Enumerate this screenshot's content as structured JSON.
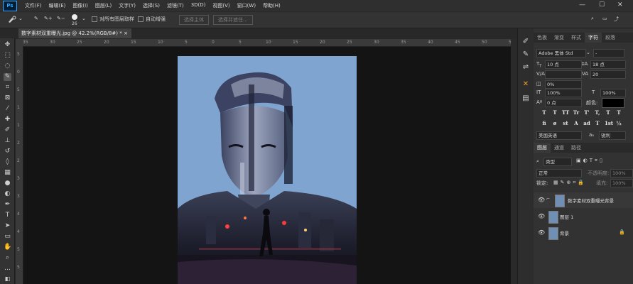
{
  "menubar": {
    "items": [
      "文件(F)",
      "编辑(E)",
      "图像(I)",
      "图层(L)",
      "文字(Y)",
      "选择(S)",
      "滤镜(T)",
      "3D(D)",
      "视图(V)",
      "窗口(W)",
      "帮助(H)"
    ],
    "app_logo": "Ps",
    "window_controls": [
      "—",
      "☐",
      "✕"
    ]
  },
  "options": {
    "brush_size": "26",
    "sample_all_layers": "对所有图层取样",
    "auto_enhance": "自动增强",
    "select_subject": "选择主体",
    "select_and_mask": "选择并遮住..."
  },
  "document": {
    "tab_title": "数字素材双重曝光.jpg @ 42.2%(RGB/8#) *",
    "close": "×"
  },
  "ruler": {
    "h_marks": [
      "35",
      "30",
      "25",
      "20",
      "15",
      "10",
      "5",
      "0",
      "5",
      "10",
      "15",
      "20",
      "25",
      "30",
      "35",
      "40",
      "45",
      "50",
      "55"
    ],
    "v_marks": [
      "5",
      "0",
      "5",
      "1",
      "1",
      "2",
      "2",
      "3",
      "3",
      "4",
      "4",
      "5",
      "5"
    ]
  },
  "panels": {
    "top_tabs": [
      "色板",
      "渐变",
      "样式",
      "字符",
      "段落"
    ],
    "active_top_tab": "字符",
    "character": {
      "font_family": "Adobe 黑体 Std",
      "font_style": "-",
      "font_size": "10 点",
      "leading": "18 点",
      "kerning": "V/A",
      "tracking": "20",
      "tsume": "0%",
      "vertical_scale": "100%",
      "horizontal_scale": "100%",
      "baseline_shift": "0 点",
      "color_label": "颜色:",
      "style_buttons": [
        "T",
        "T",
        "TT",
        "Tr",
        "T'",
        "T,",
        "T",
        "T"
      ],
      "opentype_buttons": [
        "fi",
        "ø",
        "st",
        "A",
        "ad",
        "T",
        "1st",
        "½"
      ],
      "language": "美国英语",
      "antialias": "锐利",
      "aa_prefix": "aₐ"
    },
    "layers": {
      "tabs": [
        "图层",
        "通道",
        "路径"
      ],
      "active_tab": "图层",
      "filter_kind": "类型",
      "blend_mode": "正常",
      "opacity_label": "不透明度:",
      "opacity": "100%",
      "lock_label": "锁定:",
      "fill_label": "填充:",
      "fill": "100%",
      "items": [
        {
          "name": "数字素材双重曝光背景",
          "visible": true
        },
        {
          "name": "图层 1",
          "visible": true
        },
        {
          "name": "背景",
          "visible": true,
          "locked": true
        }
      ]
    }
  },
  "colors": {
    "accent": "#31a8ff",
    "canvas_bg": "#141414",
    "photo_sky": "#7fa4cf"
  }
}
